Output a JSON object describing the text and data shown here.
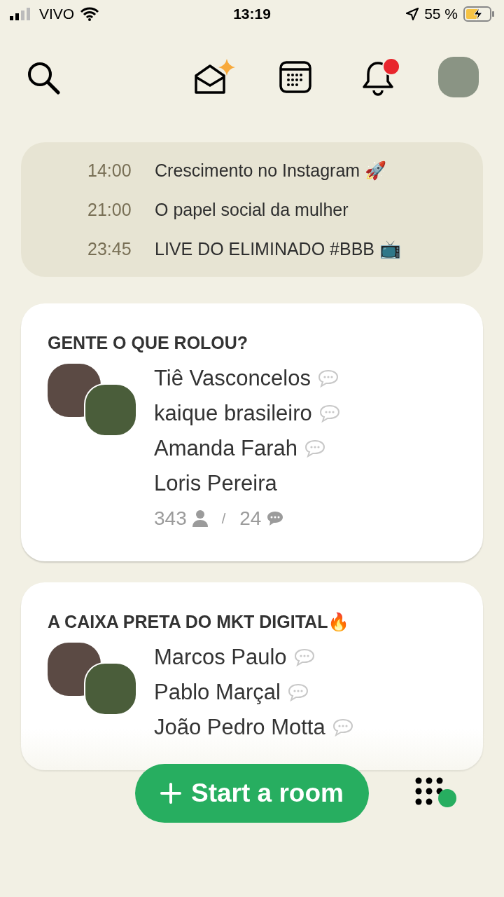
{
  "status_bar": {
    "carrier": "VIVO",
    "time": "13:19",
    "battery": "55 %"
  },
  "notifications": {
    "unread": true
  },
  "upcoming": [
    {
      "time": "14:00",
      "title": "Crescimento no Instagram 🚀"
    },
    {
      "time": "21:00",
      "title": "O papel social da mulher"
    },
    {
      "time": "23:45",
      "title": "LIVE DO ELIMINADO #BBB 📺"
    }
  ],
  "rooms": [
    {
      "title": "GENTE O QUE ROLOU?",
      "speakers": [
        {
          "name": "Tiê Vasconcelos",
          "speaking": true
        },
        {
          "name": "kaique brasileiro",
          "speaking": true
        },
        {
          "name": "Amanda Farah",
          "speaking": true
        },
        {
          "name": "Loris Pereira",
          "speaking": false
        }
      ],
      "listeners": "343",
      "separator": "/",
      "chats": "24"
    },
    {
      "title": "A CAIXA PRETA DO MKT DIGITAL🔥",
      "speakers": [
        {
          "name": "Marcos Paulo",
          "speaking": true
        },
        {
          "name": "Pablo Marçal",
          "speaking": true
        },
        {
          "name": "João Pedro Motta",
          "speaking": true
        }
      ]
    }
  ],
  "start_button": {
    "label": "Start a room"
  }
}
